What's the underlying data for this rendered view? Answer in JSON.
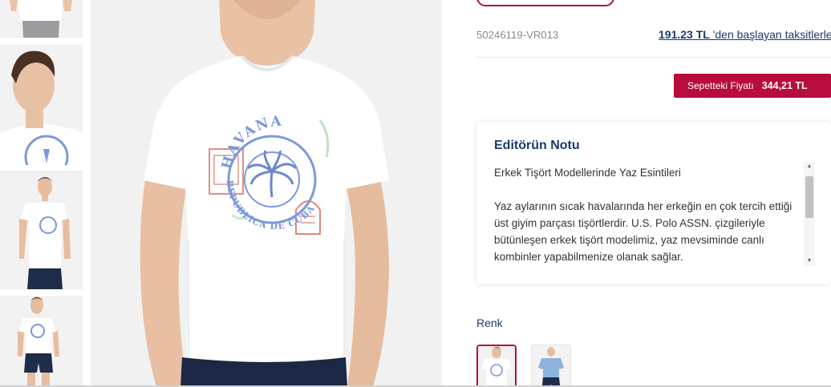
{
  "product": {
    "sku": "50246119-VR013",
    "installment": {
      "amount": "191.23 TL",
      "suffix": " 'den başlayan taksitlerle"
    },
    "basket_price": {
      "label": "Sepetteki Fiyatı",
      "amount": "344,21 TL"
    }
  },
  "editor_note": {
    "title": "Editörün Notu",
    "subtitle": "Erkek Tişört Modellerinde Yaz Esintileri",
    "body": "Yaz aylarının sıcak havalarında her erkeğin en çok tercih ettiği üst giyim parçası tişörtlerdir. U.S. Polo ASSN. çizgileriyle bütünleşen erkek tişört modelimiz, yaz mevsiminde canlı kombinler yapabilmenize olanak sağlar."
  },
  "color": {
    "label": "Renk"
  },
  "print_text": {
    "top": "HAVANA",
    "bottom": "REPUBLICA DE CUBA"
  },
  "colors": {
    "accent": "#b80c3a",
    "navy": "#1b3a6b",
    "print_blue": "#7b98d8",
    "print_red": "#d9685c"
  }
}
